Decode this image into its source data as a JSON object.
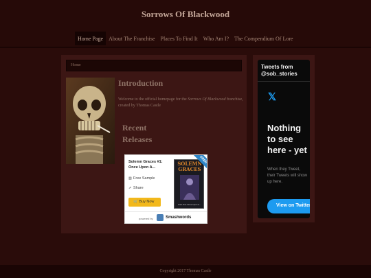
{
  "site": {
    "title": "Sorrows Of Blackwood"
  },
  "nav": {
    "items": [
      {
        "label": "Home Page"
      },
      {
        "label": "About The Franchise"
      },
      {
        "label": "Places To Find It"
      },
      {
        "label": "Who Am I?"
      },
      {
        "label": "The Compendium Of Lore"
      }
    ]
  },
  "breadcrumb": {
    "label": "Home"
  },
  "intro": {
    "title": "Introduction",
    "text_before": "Welcome to the official homepage for the ",
    "text_emph": "Sorrows Of Blackwood",
    "text_after": " franchise, created by Thomas Castle"
  },
  "recent": {
    "title": "Recent Releases"
  },
  "widget": {
    "book_title": "Solemn Graces #1: Once Upon A...",
    "free_sample": "Free Sample",
    "share": "Share",
    "buy_now": "Buy Now",
    "ribbon": "FREE",
    "cover_title": "SOLEMN GRACES",
    "cover_footer": "Part One  Once Upon A...",
    "powered_by": "powered by",
    "brand": "Smashwords"
  },
  "twitter": {
    "header": "Tweets from @sob_stories",
    "empty_title": "Nothing to see here - yet",
    "empty_text": "When they Tweet, their Tweets will show up here.",
    "button": "View on Twitter"
  },
  "footer": {
    "copyright": "Copyright 2017 Thomas Castle"
  },
  "colors": {
    "background": "#2a0c0a",
    "panel": "#3c1614",
    "twitter_blue": "#1d9bf0",
    "buy_button": "#f2b81b"
  }
}
